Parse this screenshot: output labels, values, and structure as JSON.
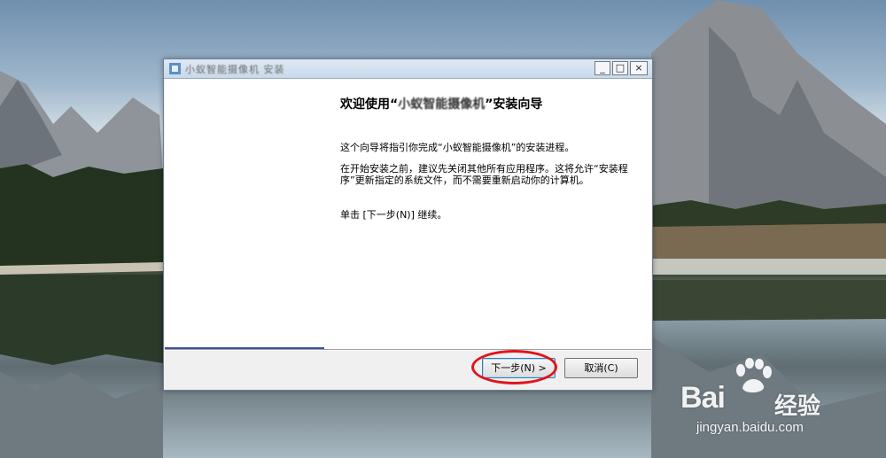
{
  "window": {
    "title": "小蚁智能摄像机 安装",
    "controls": {
      "minimize": "_",
      "maximize": "□",
      "close": "×"
    }
  },
  "wizard": {
    "heading_prefix": "欢迎使用“",
    "heading_app": "小蚁智能摄像机",
    "heading_suffix": "”安装向导",
    "para1": "这个向导将指引你完成“小蚁智能摄像机”的安装进程。",
    "para2": "在开始安装之前，建议先关闭其他所有应用程序。这将允许“安装程序”更新指定的系统文件，而不需要重新启动你的计算机。",
    "para3": "单击 [下一步(N)] 继续。"
  },
  "buttons": {
    "next": "下一步(N) >",
    "cancel": "取消(C)"
  },
  "watermark": {
    "brand": "Bai",
    "brand_cn": "经验",
    "url": "jingyan.baidu.com"
  },
  "colors": {
    "highlight": "#e3131a",
    "accent_line": "#3b4fa6"
  }
}
